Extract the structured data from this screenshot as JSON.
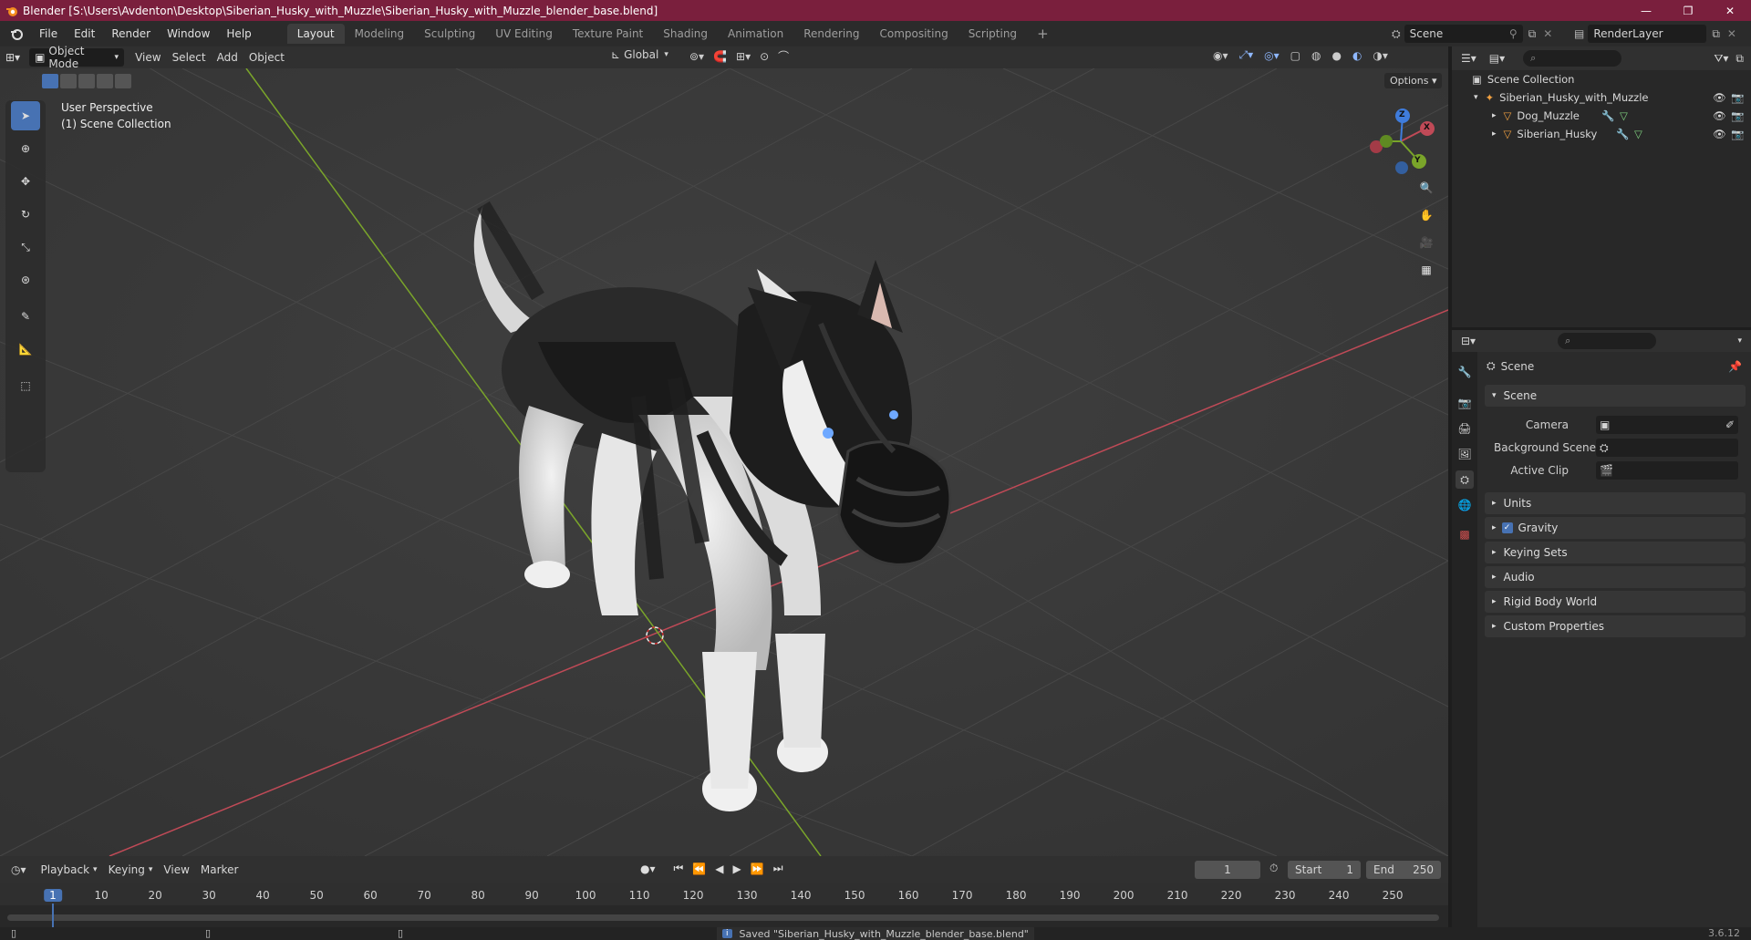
{
  "window": {
    "title": "Blender [S:\\Users\\Avdenton\\Desktop\\Siberian_Husky_with_Muzzle\\Siberian_Husky_with_Muzzle_blender_base.blend]",
    "minimize": "—",
    "maximize": "❐",
    "close": "✕"
  },
  "menu": {
    "items": [
      "File",
      "Edit",
      "Render",
      "Window",
      "Help"
    ]
  },
  "workspaces": {
    "tabs": [
      "Layout",
      "Modeling",
      "Sculpting",
      "UV Editing",
      "Texture Paint",
      "Shading",
      "Animation",
      "Rendering",
      "Compositing",
      "Scripting"
    ],
    "add": "+",
    "active_index": 0
  },
  "scene_selector": {
    "value": "Scene"
  },
  "viewlayer_selector": {
    "value": "RenderLayer"
  },
  "viewport_header": {
    "mode": "Object Mode",
    "menus": [
      "View",
      "Select",
      "Add",
      "Object"
    ],
    "orientation": "Global",
    "options": "Options"
  },
  "viewport": {
    "perspective": "User Perspective",
    "collection": "(1) Scene Collection",
    "gizmo": {
      "x": "X",
      "y": "Y",
      "z": "Z"
    }
  },
  "outliner": {
    "root": "Scene Collection",
    "items": [
      {
        "name": "Siberian_Husky_with_Muzzle",
        "depth": 1
      },
      {
        "name": "Dog_Muzzle",
        "depth": 2
      },
      {
        "name": "Siberian_Husky",
        "depth": 2
      }
    ]
  },
  "properties": {
    "context": "Scene",
    "panel_scene": "Scene",
    "fields": [
      {
        "label": "Camera",
        "value": ""
      },
      {
        "label": "Background Scene",
        "value": ""
      },
      {
        "label": "Active Clip",
        "value": ""
      }
    ],
    "panels": [
      "Units",
      "Gravity",
      "Keying Sets",
      "Audio",
      "Rigid Body World",
      "Custom Properties"
    ],
    "gravity_checked": true
  },
  "timeline": {
    "menus": [
      "Playback",
      "Keying",
      "View",
      "Marker"
    ],
    "current_frame": "1",
    "start_label": "Start",
    "start": "1",
    "end_label": "End",
    "end": "250",
    "ticks": [
      "1",
      "10",
      "20",
      "30",
      "40",
      "50",
      "60",
      "70",
      "80",
      "90",
      "100",
      "110",
      "120",
      "130",
      "140",
      "150",
      "160",
      "170",
      "180",
      "190",
      "200",
      "210",
      "220",
      "230",
      "240",
      "250"
    ]
  },
  "status": {
    "message": "Saved \"Siberian_Husky_with_Muzzle_blender_base.blend\"",
    "version": "3.6.12"
  },
  "colors": {
    "accent": "#4772b3",
    "titlebar": "#7a1f3d",
    "x_axis": "#c04a57",
    "y_axis": "#7aa52a"
  }
}
